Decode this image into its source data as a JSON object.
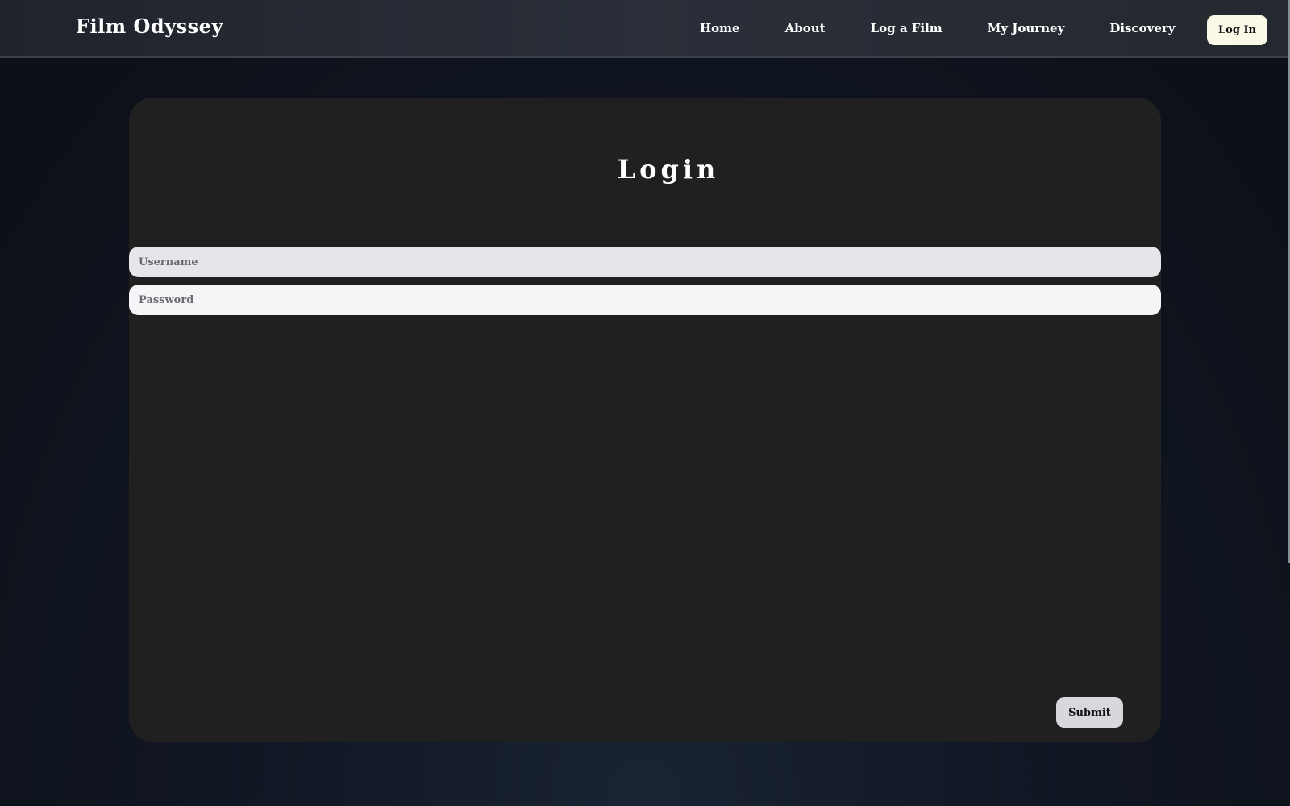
{
  "navbar": {
    "brand": "Film Odyssey",
    "links": [
      {
        "label": "Home"
      },
      {
        "label": "About"
      },
      {
        "label": "Log a Film"
      },
      {
        "label": "My Journey"
      },
      {
        "label": "Discovery"
      }
    ],
    "login_label": "Log In"
  },
  "login_form": {
    "title": "Login",
    "username_placeholder": "Username",
    "username_value": "",
    "password_placeholder": "Password",
    "password_value": "",
    "submit_label": "Submit"
  },
  "colors": {
    "page_background": "#0b0f16",
    "navbar_background": "#2a2f39",
    "card_background": "#202020",
    "login_button_background": "#fbf8e8",
    "username_field_background": "#e6e5ea",
    "password_field_background": "#f5f5f7",
    "submit_button_background": "#d8d8dc"
  }
}
